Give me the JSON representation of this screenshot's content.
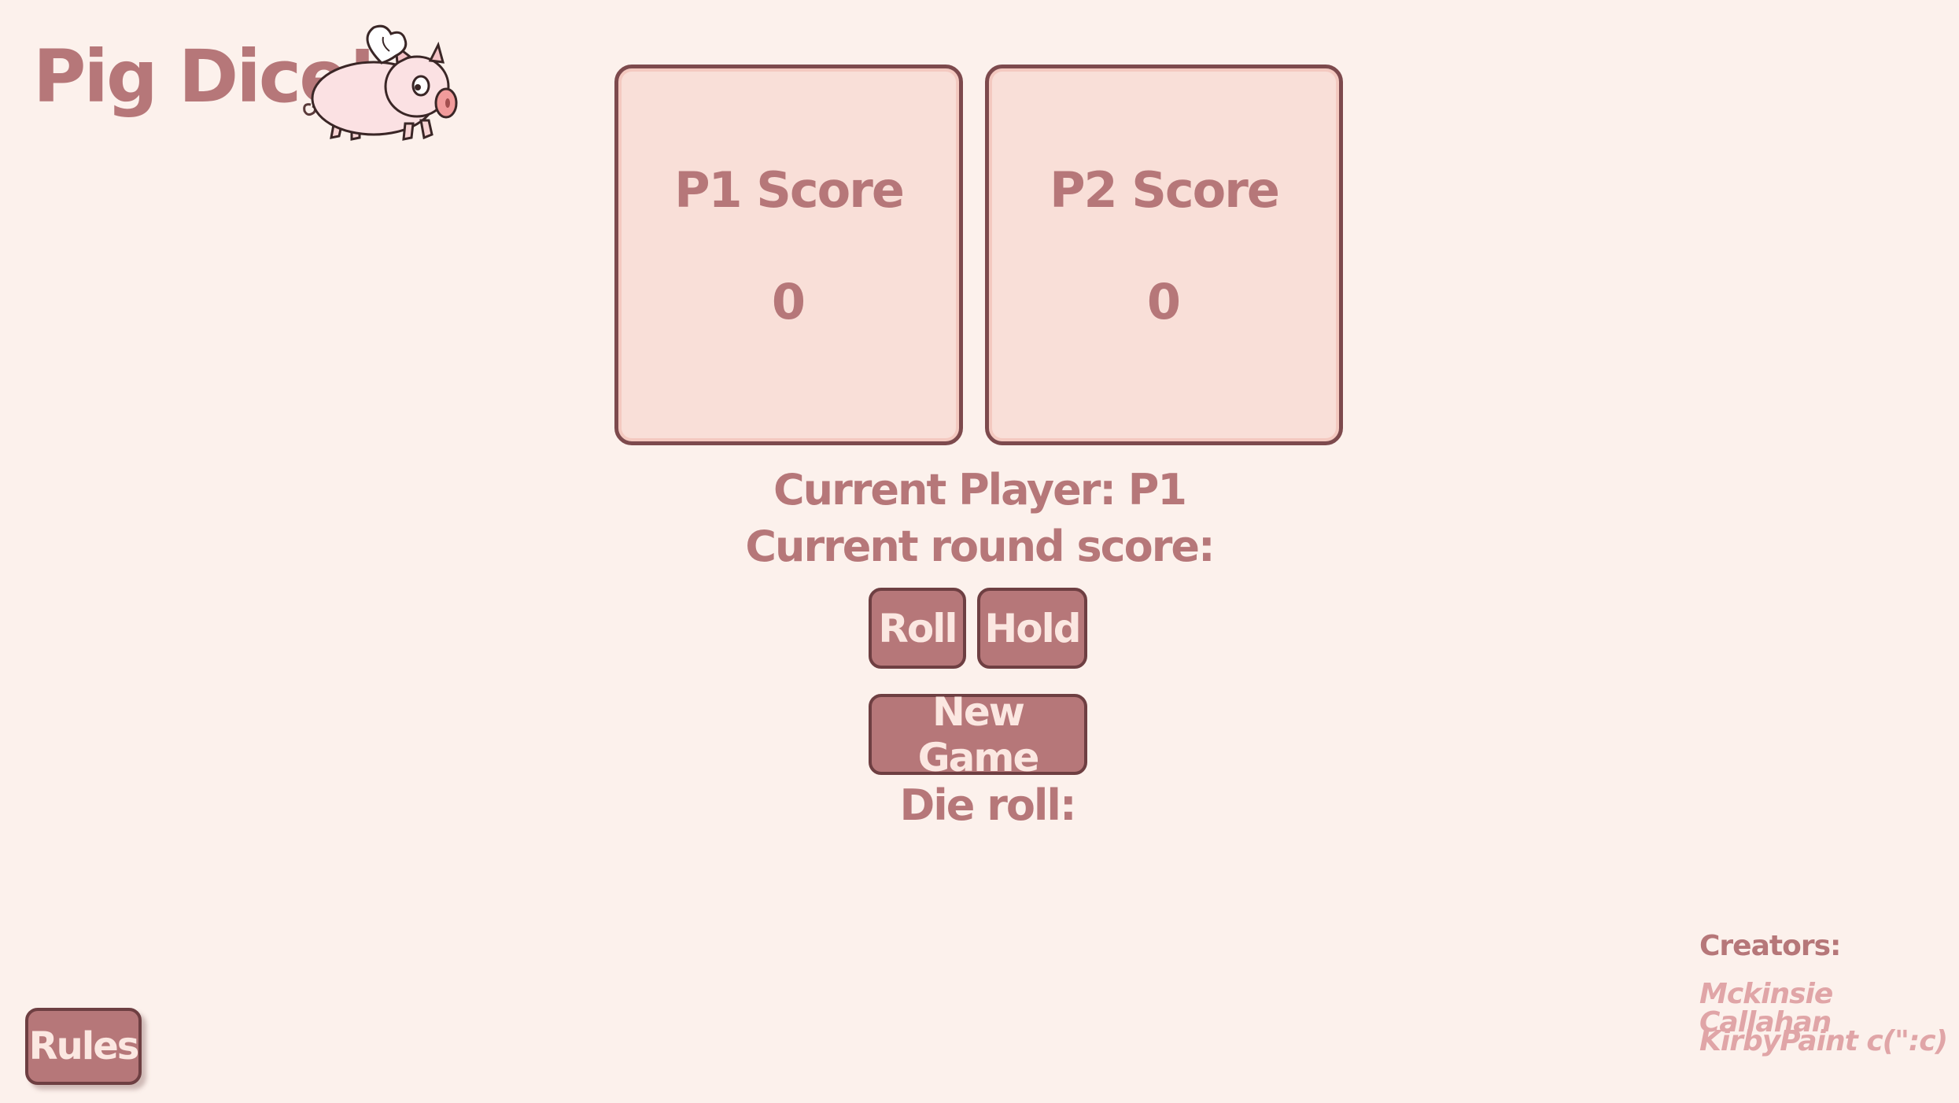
{
  "header": {
    "title": "Pig Dice!",
    "logo_icon": "flying-pig-icon"
  },
  "scoreboard": {
    "p1": {
      "label": "P1 Score",
      "value": "0"
    },
    "p2": {
      "label": "P2 Score",
      "value": "0"
    }
  },
  "status": {
    "current_player": "Current Player: P1",
    "round_score": "Current round score:",
    "die_roll": "Die roll:"
  },
  "controls": {
    "roll_label": "Roll",
    "hold_label": "Hold",
    "new_game_label": "New Game",
    "rules_label": "Rules"
  },
  "footer": {
    "heading": "Creators:",
    "names": [
      "Mckinsie Callahan",
      "KirbyPaint c(\":c)"
    ]
  },
  "colors": {
    "background": "#fcf1ec",
    "text": "#b67779",
    "box_fill": "#f9dfd8",
    "border": "#7d4a4d",
    "button_fill": "#b67779",
    "button_text": "#fbe7e1",
    "creator_names": "#e0a5a7"
  }
}
